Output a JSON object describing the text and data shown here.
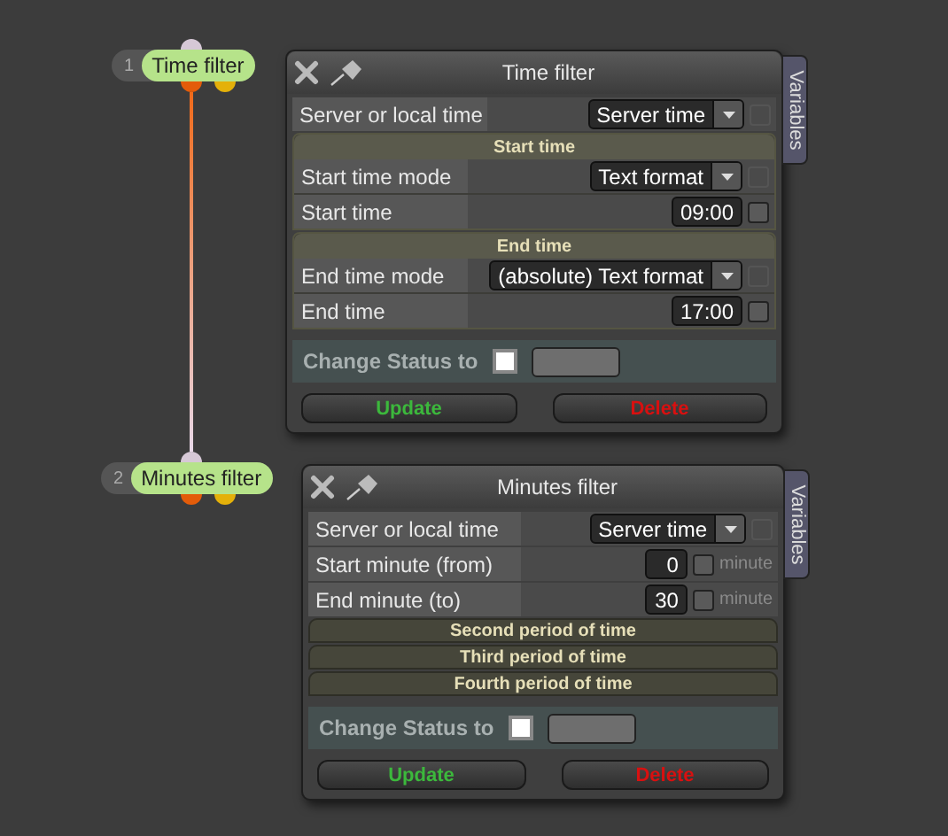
{
  "nodes": [
    {
      "number": "1",
      "label": "Time filter"
    },
    {
      "number": "2",
      "label": "Minutes filter"
    }
  ],
  "panels": [
    {
      "title": "Time filter",
      "side_tab": "Variables",
      "rows": [
        {
          "kind": "select",
          "label": "Server or local time",
          "value": "Server time",
          "checked": false
        },
        {
          "kind": "section",
          "title": "Start time",
          "rows": [
            {
              "kind": "select",
              "label": "Start time mode",
              "value": "Text format",
              "checked": false
            },
            {
              "kind": "text",
              "label": "Start time",
              "value": "09:00",
              "checked": false
            }
          ]
        },
        {
          "kind": "section",
          "title": "End time",
          "rows": [
            {
              "kind": "select",
              "label": "End time mode",
              "value": "(absolute) Text format",
              "checked": false
            },
            {
              "kind": "text",
              "label": "End time",
              "value": "17:00",
              "checked": false
            }
          ]
        },
        {
          "kind": "status",
          "label": "Change Status to",
          "checked": false
        }
      ],
      "buttons": [
        {
          "kind": "update",
          "label": "Update"
        },
        {
          "kind": "delete",
          "label": "Delete"
        }
      ]
    },
    {
      "title": "Minutes filter",
      "side_tab": "Variables",
      "rows": [
        {
          "kind": "select",
          "label": "Server or local time",
          "value": "Server time",
          "checked": false
        },
        {
          "kind": "text",
          "label": "Start minute (from)",
          "value": "0",
          "checked": false,
          "unit": "minute"
        },
        {
          "kind": "text",
          "label": "End minute (to)",
          "value": "30",
          "checked": false,
          "unit": "minute"
        },
        {
          "kind": "period",
          "title": "Second period of time"
        },
        {
          "kind": "period",
          "title": "Third period of time"
        },
        {
          "kind": "period",
          "title": "Fourth period of time"
        },
        {
          "kind": "status",
          "label": "Change Status to",
          "checked": false
        }
      ],
      "buttons": [
        {
          "kind": "update",
          "label": "Update"
        },
        {
          "kind": "delete",
          "label": "Delete"
        }
      ]
    }
  ]
}
